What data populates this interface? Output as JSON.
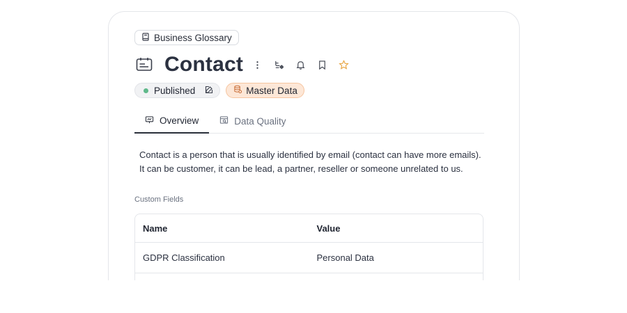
{
  "breadcrumb": {
    "label": "Business Glossary",
    "icon": "book-icon"
  },
  "header": {
    "title": "Contact",
    "icon": "id-card-icon",
    "actions": [
      "more-vertical-icon",
      "lineage-icon",
      "bell-icon",
      "bookmark-icon",
      "star-icon"
    ]
  },
  "badges": {
    "status": {
      "label": "Published",
      "color": "#5fb98a"
    },
    "domain": {
      "label": "Master Data",
      "background": "#fde7d7",
      "border": "#f6c5a0"
    }
  },
  "tabs": [
    {
      "label": "Overview",
      "active": true
    },
    {
      "label": "Data Quality",
      "active": false
    }
  ],
  "description": {
    "line1": "Contact is a person that is usually identified by email (contact can have more emails).",
    "line2": "It can be customer, it can be lead, a partner, reseller or someone unrelated to us."
  },
  "custom_fields": {
    "label": "Custom Fields",
    "columns": [
      "Name",
      "Value"
    ],
    "rows": [
      {
        "name": "GDPR Classification",
        "value": "Personal Data"
      }
    ]
  },
  "colors": {
    "star": "#e8a33c",
    "accent": "#2a2f3a"
  }
}
